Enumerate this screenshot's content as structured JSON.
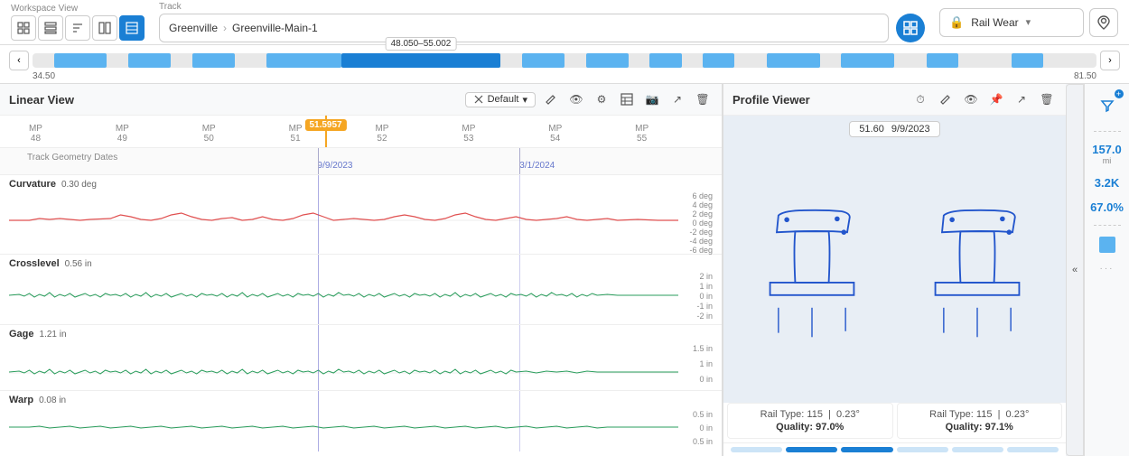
{
  "toolbar": {
    "workspace_label": "Workspace View",
    "track_label": "Track",
    "breadcrumb_city": "Greenville",
    "breadcrumb_sep": ">",
    "breadcrumb_track": "Greenville-Main-1",
    "rail_wear_label": "Rail Wear",
    "view_icons": [
      "grid-2x2",
      "grid-list",
      "sort",
      "split-v",
      "layers"
    ]
  },
  "range": {
    "min_label": "34.50",
    "max_label": "81.50",
    "selected_label": "48.050–55.002"
  },
  "linear_view": {
    "title": "Linear View",
    "default_label": "Default",
    "current_mp": "51.5957",
    "mp_labels": [
      "MP 48",
      "MP 49",
      "MP 50",
      "MP 51",
      "MP 52",
      "MP 53",
      "MP 54",
      "MP 55"
    ],
    "track_geometry": "Track Geometry Dates",
    "date1": "9/9/2023",
    "date2": "3/1/2024",
    "sections": [
      {
        "label": "Curvature",
        "value": "0.30 deg",
        "y_labels": [
          "6 deg",
          "4 deg",
          "2 deg",
          "0 deg",
          "-2 deg",
          "-4 deg",
          "-6 deg"
        ],
        "color": "#e05050"
      },
      {
        "label": "Crosslevel",
        "value": "0.56 in",
        "y_labels": [
          "2 in",
          "1 in",
          "0 in",
          "-1 in",
          "-2 in"
        ],
        "color": "#2a9d5c"
      },
      {
        "label": "Gage",
        "value": "1.21 in",
        "y_labels": [
          "1.5 in",
          "1 in",
          "0 in"
        ],
        "color": "#2a9d5c"
      },
      {
        "label": "Warp",
        "value": "0.08 in",
        "y_labels": [
          "0.5 in",
          "0 in",
          "0.5 in"
        ],
        "color": "#2a9d5c"
      }
    ]
  },
  "profile_viewer": {
    "title": "Profile Viewer",
    "mp_label": "51.60",
    "date_label": "9/9/2023",
    "rail_left": {
      "type": "Rail Type: 115",
      "angle": "0.23°",
      "quality": "Quality: 97.0%"
    },
    "rail_right": {
      "type": "Rail Type: 115",
      "angle": "0.23°",
      "quality": "Quality: 97.1%"
    }
  },
  "right_sidebar": {
    "stat1_value": "157.0",
    "stat1_unit": "mi",
    "stat2_value": "3.2K",
    "stat3_value": "67.0%"
  },
  "icons": {
    "filter_plus": "⊕",
    "chevron_left": "‹",
    "chevron_right": "›",
    "chevron_down": "⌄",
    "double_chevron_left": "«",
    "lock": "🔒",
    "location": "📍",
    "grid2": "▦",
    "layers": "⊟",
    "clock": "⏱",
    "eye": "👁",
    "settings": "⚙",
    "pin": "📌",
    "export": "↗",
    "trash": "🗑",
    "camera": "📷",
    "table_icon": "⊞",
    "bookmark": "⊡"
  }
}
